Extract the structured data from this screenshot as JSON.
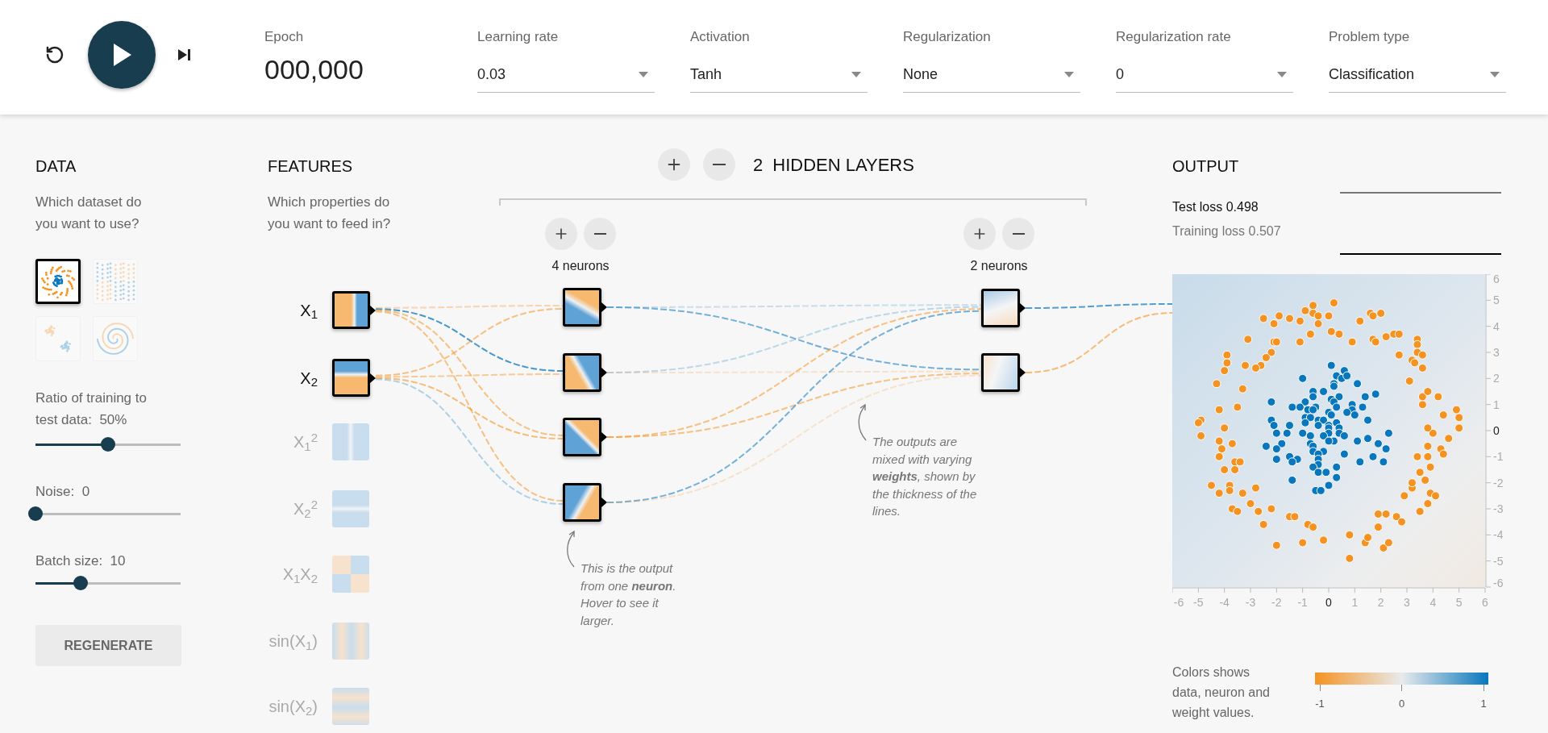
{
  "toolbar": {
    "epoch": {
      "label": "Epoch",
      "value": "000,000"
    },
    "dropdowns": [
      {
        "label": "Learning rate",
        "value": "0.03"
      },
      {
        "label": "Activation",
        "value": "Tanh"
      },
      {
        "label": "Regularization",
        "value": "None"
      },
      {
        "label": "Regularization rate",
        "value": "0"
      },
      {
        "label": "Problem type",
        "value": "Classification"
      }
    ]
  },
  "data": {
    "title": "DATA",
    "prompt": "Which dataset do you want to use?",
    "datasets": [
      {
        "kind": "circle",
        "selected": true
      },
      {
        "kind": "xor",
        "selected": false
      },
      {
        "kind": "gauss",
        "selected": false
      },
      {
        "kind": "spiral",
        "selected": false
      }
    ],
    "sliders": [
      {
        "label": "Ratio of training to test data:",
        "value": "50%",
        "level": 0.5
      },
      {
        "label": "Noise:",
        "value": "0",
        "level": 0
      },
      {
        "label": "Batch size:",
        "value": "10",
        "level": 0.31
      }
    ],
    "button": "REGENERATE"
  },
  "features": {
    "title": "FEATURES",
    "prompt": "Which properties do you want to feed in?",
    "items": [
      {
        "label": "X$_{1}$",
        "kind": "x1",
        "selected": true
      },
      {
        "label": "X$_{2}$",
        "kind": "x2",
        "selected": true
      },
      {
        "label": "X$_{1}$$^{2}$",
        "kind": "x1sq",
        "selected": false
      },
      {
        "label": "X$_{2}$$^{2}$",
        "kind": "x2sq",
        "selected": false
      },
      {
        "label": "X$_{1}$X$_{2}$",
        "kind": "x1x2",
        "selected": false
      },
      {
        "label": "sin(X$_{1}$)",
        "kind": "sin1",
        "selected": false
      },
      {
        "label": "sin(X$_{2}$)",
        "kind": "sin2",
        "selected": false
      }
    ]
  },
  "network": {
    "count": "2",
    "title": "HIDDEN LAYERS",
    "layers": [
      {
        "neurons": "4 neurons"
      },
      {
        "neurons": "2 neurons"
      }
    ],
    "annotations": [
      "This is the output from one **neuron**. Hover to see it larger.",
      "The outputs are mixed with varying **weights**, shown by the thickness of the lines."
    ]
  },
  "output": {
    "title": "OUTPUT",
    "test_loss": "Test loss 0.498",
    "training_loss": "Training loss 0.507",
    "chart_data": {
      "type": "scatter",
      "xlim": [
        -6,
        6
      ],
      "ylim": [
        -6,
        6
      ],
      "xticks": [
        -6,
        -5,
        -4,
        -3,
        -2,
        -1,
        0,
        1,
        2,
        3,
        4,
        5,
        6
      ],
      "yticks": [
        -6,
        -5,
        -4,
        -3,
        -2,
        -1,
        0,
        1,
        2,
        3,
        4,
        5,
        6
      ],
      "series": [
        {
          "color": "#f59322",
          "x": [
            0.2,
            -0.6,
            -0.9,
            -0.6,
            -0.4,
            -0.4,
            0,
            -1.1,
            -1.5,
            -1.9,
            -2.1,
            -2.5,
            1.6,
            1.7,
            2.0,
            1.2,
            -0.7,
            0.1,
            0.4,
            -1.1,
            0.9,
            1.7,
            1.8,
            2.2,
            2.5,
            2.7,
            3.4,
            3.4,
            3.4,
            3.2,
            3.3,
            3.6,
            3.6,
            2.7,
            3.1,
            -3.1,
            -2.1,
            -2.0,
            -2.2,
            -2.4,
            -2.6,
            -2.8,
            -3.2,
            -3.9,
            -3.9,
            -4.0,
            -4.3,
            -3.3,
            -4.2,
            -3.5,
            -4.9,
            -5.0,
            -4.9,
            -4.0,
            -4.2,
            -4.1,
            -4.2,
            -3.7,
            -3.6,
            -3.4,
            -4.0,
            -3.6,
            -4.5,
            -4.2,
            -3.8,
            -3.8,
            -3.3,
            -2.8,
            -3.7,
            -3.5,
            -3.0,
            -2.7,
            -2.2,
            -2.5,
            -1.5,
            -1.3,
            -0.8,
            -0.6,
            -2.0,
            -1.0,
            -0.2,
            0.8,
            0.8,
            1.4,
            1.5,
            2.1,
            2.3,
            1.9,
            1.9,
            2.2,
            2.6,
            2.8,
            2.9,
            3.2,
            3.2,
            3.7,
            3.5,
            3.8,
            3.9,
            4.1,
            3.5,
            3.9,
            3.8,
            3.4,
            3.8,
            4.3,
            4.4,
            4.6,
            4.0,
            3.8,
            5.0,
            5.0,
            4.9,
            4.4,
            3.6,
            3.6,
            3.8,
            4.2
          ],
          "values": [
            4.9,
            4.8,
            4.6,
            4.5,
            4.4,
            4.1,
            4.4,
            4.2,
            4.3,
            4.4,
            4.1,
            4.3,
            4.5,
            4.4,
            4.5,
            4.2,
            3.7,
            3.8,
            3.7,
            3.4,
            3.4,
            3.5,
            3.4,
            3.6,
            3.7,
            3.7,
            3.5,
            3.3,
            3.0,
            2.7,
            2.6,
            2.9,
            2.4,
            2.9,
            1.9,
            3.5,
            3.4,
            3.4,
            3.0,
            2.8,
            2.5,
            2.4,
            2.5,
            2.9,
            2.6,
            2.3,
            1.8,
            1.6,
            0.8,
            0.9,
            0.4,
            0.3,
            -0.2,
            0.1,
            -0.4,
            -0.7,
            -1.0,
            -0.5,
            -1.2,
            -1.2,
            -1.5,
            -1.5,
            -2.1,
            -2.4,
            -2.1,
            -2.3,
            -2.4,
            -2.2,
            -3.0,
            -3.1,
            -2.8,
            -3.1,
            -3.0,
            -3.6,
            -3.3,
            -3.3,
            -3.6,
            -3.7,
            -4.4,
            -4.3,
            -4.2,
            -4.0,
            -4.9,
            -4.3,
            -4.1,
            -4.5,
            -4.3,
            -3.7,
            -3.2,
            -3.2,
            -3.3,
            -3.5,
            -2.5,
            -2.2,
            -2.0,
            -1.9,
            -3.1,
            -2.8,
            -2.4,
            -2.5,
            -1.6,
            -1.4,
            -1.0,
            -1.0,
            -0.6,
            -0.7,
            -0.9,
            -0.3,
            -0.1,
            0.1,
            0.1,
            0.5,
            0.8,
            0.6,
            1.0,
            1.3,
            1.5,
            1.3
          ]
        },
        {
          "color": "#0877bd",
          "x": [
            0.1,
            0.6,
            0.3,
            0.5,
            0.7,
            -1.0,
            1.1,
            0.2,
            0.2,
            -0.2,
            -0.6,
            -0.6,
            0.4,
            1.4,
            1.8,
            0.1,
            0.2,
            -0.9,
            -2.2,
            -1.4,
            -1.1,
            -0.5,
            0.3,
            0.9,
            0.9,
            1.3,
            -0.8,
            -0.6,
            0,
            0.7,
            1.0,
            -0.9,
            -0.7,
            0.1,
            -2.2,
            -0.9,
            -0.4,
            -0.2,
            1.5,
            -0.4,
            0,
            0.3,
            -2.1,
            -1.5,
            0,
            0.4,
            0,
            -1.6,
            -2.0,
            -1.0,
            -0.7,
            -0.2,
            0.4,
            0.6,
            2.3,
            0.2,
            0,
            -0.7,
            -1.8,
            1.1,
            1.5,
            1.9,
            2.2,
            -0.6,
            -2.4,
            -2.0,
            -0.6,
            -0.2,
            -0.4,
            0.6,
            -1.5,
            -1.2,
            -2.0,
            -0.4,
            1.7,
            -1.4,
            -0.4,
            1.2,
            2.1,
            0.3,
            -0.6,
            -0.4,
            -0.1,
            0.3,
            -1.4,
            0,
            -0.5,
            -0.3
          ],
          "values": [
            2.5,
            2.3,
            2.1,
            2.0,
            2.1,
            2.0,
            1.8,
            1.8,
            1.7,
            1.5,
            1.5,
            1.3,
            1.3,
            1.3,
            1.4,
            1.2,
            1.1,
            1.1,
            1.1,
            0.9,
            0.9,
            0.9,
            0.9,
            1.0,
            0.8,
            0.9,
            0.8,
            0.8,
            0.7,
            0.7,
            0.6,
            0.5,
            0.5,
            0.6,
            0.4,
            0.3,
            0.4,
            0.4,
            0.4,
            0.2,
            0.2,
            0.3,
            0.2,
            0.2,
            0.1,
            0.1,
            -0.1,
            -0.1,
            -0.1,
            -0.1,
            -0.2,
            -0.2,
            -0.1,
            -0.2,
            -0.1,
            -0.4,
            -0.4,
            -0.5,
            -0.5,
            -0.4,
            -0.3,
            -0.5,
            -0.7,
            -0.6,
            -0.6,
            -0.7,
            -0.8,
            -0.8,
            -0.9,
            -0.9,
            -1.0,
            -1.1,
            -1.1,
            -1.1,
            -1.0,
            -1.2,
            -1.3,
            -1.2,
            -1.2,
            -1.4,
            -1.4,
            -1.6,
            -1.6,
            -1.8,
            -1.9,
            -2.1,
            -2.3,
            -2.3
          ]
        }
      ]
    },
    "legend": {
      "text": "Colors shows data, neuron and weight values.",
      "ticks": [
        "-1",
        "0",
        "1"
      ]
    }
  }
}
